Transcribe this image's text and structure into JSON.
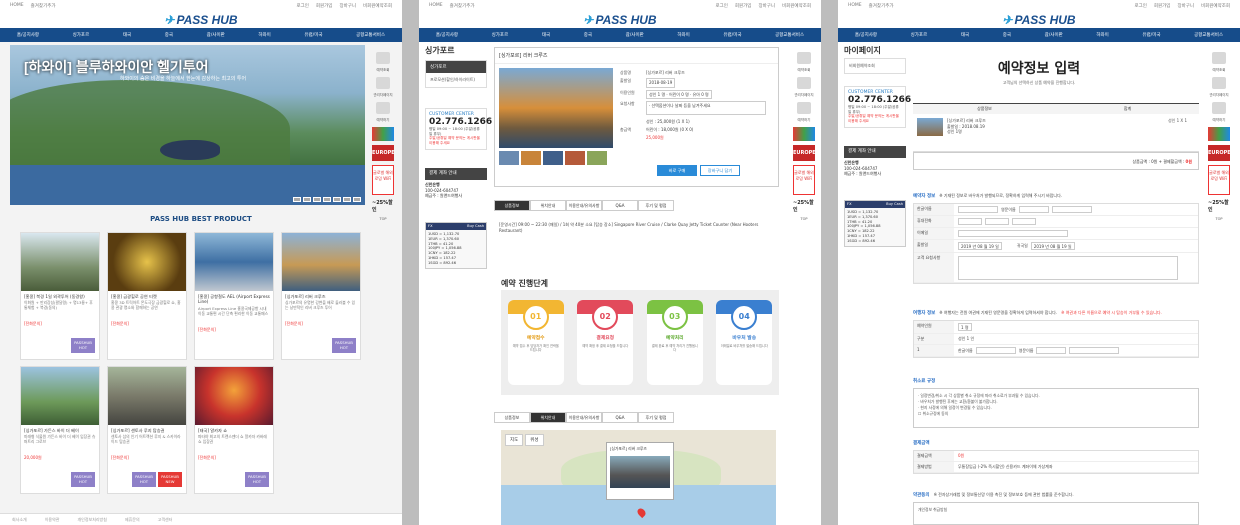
{
  "header": {
    "home": "HOME",
    "fav": "즐겨찾기추가",
    "links": [
      "로그인",
      "회원가입",
      "장바구니",
      "비회원예약조회"
    ],
    "logo": "PASS HUB",
    "nav": [
      "홈/공지사항",
      "싱가포르",
      "태국",
      "중국",
      "괌/사이판",
      "하와이",
      "유럽/미국",
      "공항교통서비스"
    ]
  },
  "side": {
    "items": [
      "예약조회",
      "관리자페이지",
      "예약하기"
    ],
    "europe": "EUROPE",
    "wifi": "글로벌 해외로밍 WiFi",
    "pct": "~25%할인",
    "top": "TOP"
  },
  "main": {
    "hero_title": "[하와이] 블루하와이안 헬기투어",
    "hero_sub": "하와이의 숨은 비경을 하늘에서 한눈에 감상하는 최고의 투어",
    "best": "PASS HUB BEST PRODUCT",
    "cards": [
      {
        "t": "[홍콩] 북경 1일 외곽투어 (동경왕)",
        "d": "이화원 + 만리장성(팔달령) + 명13릉+ 후통체험 + 북경(동의)",
        "p": "[전화문의]",
        "tag": "PASSHUB HOT"
      },
      {
        "t": "[홍콩] 금광힐로 공연 티켓",
        "d": "홍콩 3D 트릭아트 몬도극장 금광힐로 쇼, 홍콩 관광 명소와 함께하는 공연",
        "p": "[전화문의]",
        "tag": ""
      },
      {
        "t": "[홍콩] 공항철도 AEL (Airport Express Line)",
        "d": "Airport Express Line 홍콩국제공항 시내 이동 교통편 시간 단축 편리한 이동 교통패스",
        "p": "[전화문의]",
        "tag": ""
      },
      {
        "t": "[싱가포르] 리버 크루즈",
        "d": "싱가포르의 유명한 강변을 배로 둘러볼 수 있는 낭만적인 리버 크루즈 투어",
        "p": "[전화문의]",
        "tag": "PASSHUB HOT"
      },
      {
        "t": "[싱가포르] 가든스 바이 더 베이",
        "d": "미래형 식물원 가든스 바이 더 베이 입장권 슈퍼트리 그로브",
        "p": "20,000원",
        "tag": "PASSHUB HOT"
      },
      {
        "t": "[싱가포르] 센토사 루지 탑승권",
        "d": "센토사 섬의 인기 어트랙션 루지 & 스카이라이드 탑승권",
        "p": "[전화문의]",
        "tag": "PASSHUB HOT",
        "tag2": "PASSHUB NEW"
      },
      {
        "t": "[태국] 알카자 쇼",
        "d": "파타야 최고의 트랜스젠더 쇼 알카자 카바레 쇼 입장권",
        "p": "[전화문의]",
        "tag": "PASSHUB HOT"
      }
    ],
    "footer": [
      "회사소개",
      "이용약관",
      "개인정보처리방침",
      "제휴문의",
      "고객센터"
    ]
  },
  "detail": {
    "cat": "싱가포르",
    "menu_head": "싱가포르",
    "menu_item": "프로모션(할인/하이라이트)",
    "cc_label": "CUSTOMER CENTER",
    "cc_num": "02.776.1266",
    "cc_txt": "평일 09:00 ~ 18:00 (주말/공휴일 휴무)",
    "cc_red": "주말/공휴일 예약 문의는 게시판을 이용해 주세요",
    "bank_head": "결제 계좌 안내",
    "bank": "신한은행",
    "acct": "100-024-604747",
    "holder": "예금주 : 원앤드여행사",
    "fx_head": "FX",
    "fx_sub": "Buy Cash",
    "fx": [
      "1USD = 1,132.70",
      "1EUR = 1,370.60",
      "1THB = 41.20",
      "100JPY = 1,056.88",
      "1CNY = 182.22",
      "1HKD = 157.47",
      "1SGD = 892.46"
    ],
    "title": "[싱가포르] 리버 크루즈",
    "form": [
      [
        "상품명",
        "[싱가포르] 리버 크루즈"
      ],
      [
        "출발일",
        "2018-08-19"
      ],
      [
        "이용인원",
        "성인 1 명 · 어린이 0 명 · 유아 0 명"
      ],
      [
        "요청사항",
        "· 선택옵션이나 날짜 등을 남겨주세요"
      ],
      [
        "옵션",
        "성인 : 25,000원 (1 X 1)"
      ],
      [
        "옵션2",
        "어린이 : 18,000원 (0 X 0)"
      ],
      [
        "총금액",
        "25,000원"
      ]
    ],
    "btn1": "바로 구매",
    "btn2": "장바구니 담기",
    "tabs": [
      "상품정보",
      "위치안내",
      "이용안내/유의사항",
      "Q&A",
      "후기 및 평점"
    ],
    "info": "[운영시간] 09:00 ~ 22:30 (매일) / 1회 약 40분 소요  [탑승 장소] Singapore River Cruise / Clarke Quay Jetty Ticket Counter (Near Hooters Restaurant)",
    "steps_title": "예약 진행단계",
    "steps": [
      {
        "n": "01",
        "l": "예약접수",
        "t": "예약 접수 후 담당자가 확인 연락을 드립니다"
      },
      {
        "n": "02",
        "l": "결제요청",
        "t": "예약 확정 후 결제 요청을 드립니다"
      },
      {
        "n": "03",
        "l": "예약처리",
        "t": "결제 완료 후 예약 처리가 진행됩니다"
      },
      {
        "n": "04",
        "l": "바우처 발송",
        "t": "이메일로 바우처를 발송해 드립니다"
      }
    ],
    "map_ctrl": [
      "지도",
      "위성"
    ],
    "map_pop": "[싱가포르] 리버 크루즈"
  },
  "reserve": {
    "cat": "마이페이지",
    "menu_item": "비회원예약조회",
    "title": "예약정보 입력",
    "sub": "고객님의 선택하신 상품 예약을 진행합니다.",
    "th": [
      "상품정보",
      "합계"
    ],
    "item": "[싱가포르] 리버 크루즈",
    "date": "출발일 : 2018.08.19",
    "cnt": "성인 1명",
    "qty": "성인 1 X 1",
    "sum_label": "상품금액 : 0원 + 결제할금액 :",
    "sum": "0원",
    "s1": "예약자 정보",
    "s1note": "※ 기재된 정보로 바우처가 발행되므로, 정확하게 입력해 주시기 바랍니다.",
    "f1": [
      [
        "한글이름",
        "영문이름"
      ],
      [
        "휴대전화",
        ""
      ],
      [
        "이메일",
        ""
      ],
      [
        "출발일",
        "귀국일"
      ],
      [
        "고객 요청사항",
        ""
      ]
    ],
    "dep": "2019 년 08 월 19 일",
    "ret": "2019 년 08 월 19 일",
    "s2": "여행자 정보",
    "s2note": "※ 여행자는 전원 여권에 기재된 영문명을 정확하게 입력하셔야 합니다.",
    "s2red": "※ 여권과 다른 이름으로 예약 시 탑승이 거부될 수 있습니다.",
    "f2": [
      "예약인원",
      "구분",
      "1",
      "한글이름",
      "영문이름"
    ],
    "pcount": "1 명",
    "sdesc": "성인 1 인",
    "s3": "취소료 규정",
    "agree": [
      "· 일정변경/취소 시 각 상품별 취소 규정에 따라 취소료가 부과될 수 있습니다.",
      "· 바우처가 발행된 후에는 교환/환불이 불가합니다.",
      "· 현지 사정에 의해 일정이 변경될 수 있습니다."
    ],
    "agree_chk": "취소규정에 동의",
    "s4": "결제금액",
    "pay": [
      [
        "결제금액",
        "0원"
      ],
      [
        "결제방법",
        "무통장입금 (-2% 즉시할인)   신용카드   계좌이체   가상계좌"
      ]
    ],
    "s5": "약관동의",
    "s5note": "※ 전자상거래법 및 정보통신망 이용 촉진 및 정보보호 등에 관한 법률을 준수합니다.",
    "privacy": "개인정보 취급방침"
  }
}
